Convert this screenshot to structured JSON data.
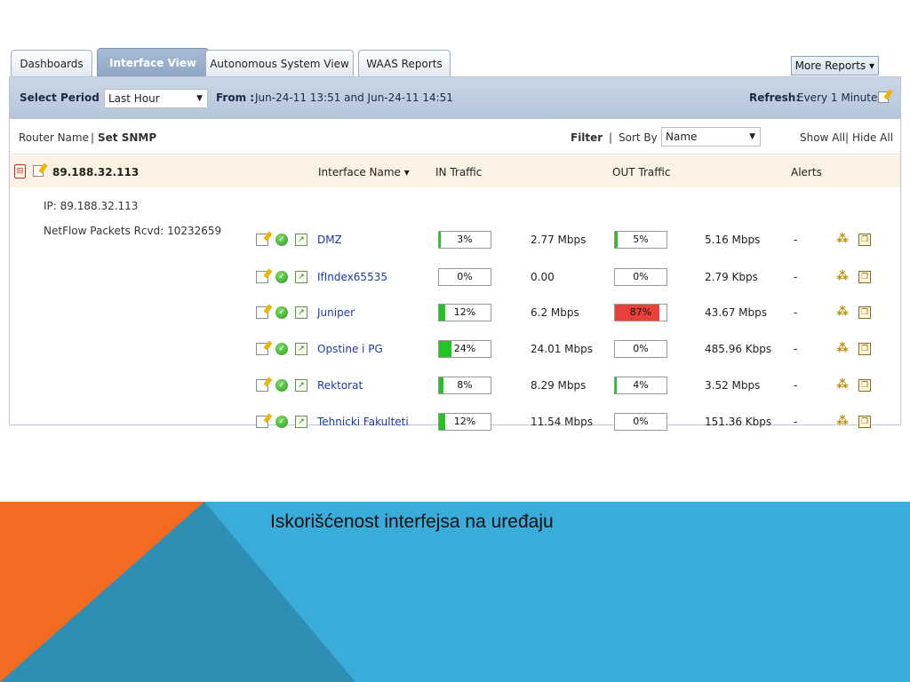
{
  "tabs": [
    "Dashboards",
    "Interface View",
    "Autonomous System View",
    "WAAS Reports"
  ],
  "more_reports": "More Reports ▾",
  "period": {
    "select_label": "Select Period",
    "select_value": "Last Hour",
    "from_label": "From :",
    "from_value": "Jun-24-11 13:51 and Jun-24-11 14:51",
    "refresh_label": "Refresh:",
    "refresh_value": "Every 1 Minute"
  },
  "toolbar": {
    "router_name": "Router Name",
    "separator": "|",
    "set_snmp": "Set SNMP",
    "filter": "Filter",
    "sort_by": "Sort By",
    "sort_value": "Name",
    "show_all": "Show All",
    "hide_all": "Hide All"
  },
  "router": {
    "ip_title": "89.188.32.113",
    "col_interface": "Interface Name ▾",
    "col_in": "IN Traffic",
    "col_out": "OUT Traffic",
    "col_alerts": "Alerts",
    "ip_line": "IP: 89.188.32.113",
    "netflow_line": "NetFlow Packets Rcvd: 10232659"
  },
  "colors": {
    "in_fill": "#22c322",
    "out_high": "#e8403a",
    "out_fill": "#22c322",
    "orange": "#f26b21",
    "teal": "#2f8eb3",
    "sky": "#3aacda"
  },
  "interfaces": [
    {
      "name": "DMZ",
      "in_pct": "3%",
      "in_frac": 0.03,
      "in_rate": "2.77 Mbps",
      "out_pct": "5%",
      "out_frac": 0.05,
      "out_rate": "5.16 Mbps",
      "alert": "-"
    },
    {
      "name": "IfIndex65535",
      "in_pct": "0%",
      "in_frac": 0,
      "in_rate": "0.00",
      "out_pct": "0%",
      "out_frac": 0,
      "out_rate": "2.79 Kbps",
      "alert": "-"
    },
    {
      "name": "Juniper",
      "in_pct": "12%",
      "in_frac": 0.12,
      "in_rate": "6.2 Mbps",
      "out_pct": "87%",
      "out_frac": 0.87,
      "out_rate": "43.67 Mbps",
      "alert": "-"
    },
    {
      "name": "Opstine i PG",
      "in_pct": "24%",
      "in_frac": 0.24,
      "in_rate": "24.01 Mbps",
      "out_pct": "0%",
      "out_frac": 0,
      "out_rate": "485.96 Kbps",
      "alert": "-"
    },
    {
      "name": "Rektorat",
      "in_pct": "8%",
      "in_frac": 0.08,
      "in_rate": "8.29 Mbps",
      "out_pct": "4%",
      "out_frac": 0.04,
      "out_rate": "3.52 Mbps",
      "alert": "-"
    },
    {
      "name": "Tehnicki Fakulteti",
      "in_pct": "12%",
      "in_frac": 0.12,
      "in_rate": "11.54 Mbps",
      "out_pct": "0%",
      "out_frac": 0,
      "out_rate": "151.36 Kbps",
      "alert": "-"
    }
  ],
  "caption": "Iskorišćenost interfejsa na uređaju"
}
